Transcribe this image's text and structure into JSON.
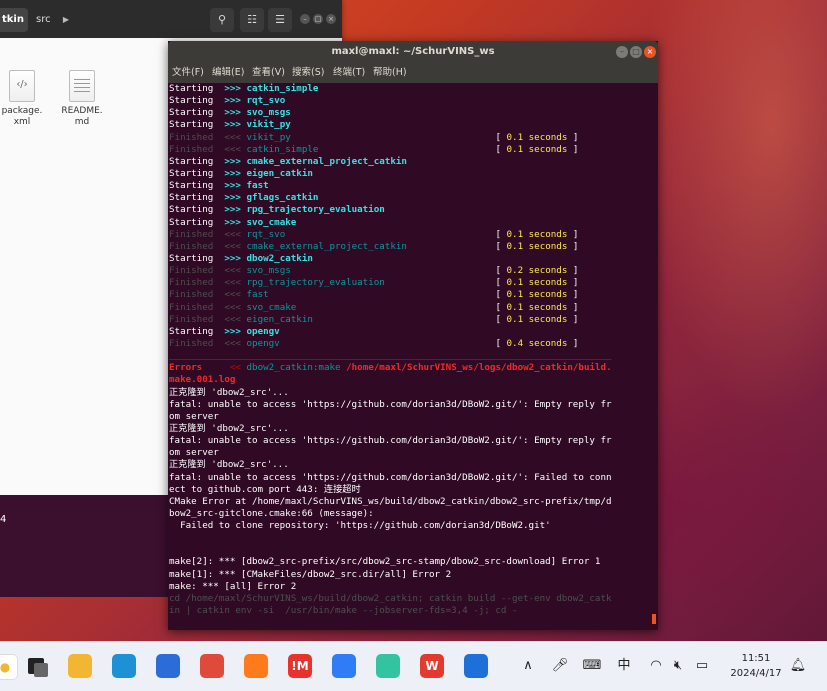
{
  "file_manager": {
    "breadcrumb": [
      "tkin",
      "src"
    ],
    "files": [
      {
        "name": "package.\nxml",
        "icon": "xml-file-icon"
      },
      {
        "name": "README.\nmd",
        "icon": "text-file-icon"
      }
    ]
  },
  "left_strip_text": "4",
  "terminal": {
    "title": "maxl@maxl: ~/SchurVINS_ws",
    "menu": [
      "文件(F)",
      "编辑(E)",
      "查看(V)",
      "搜索(S)",
      "终端(T)",
      "帮助(H)"
    ],
    "lines": [
      {
        "a": "Starting",
        "b": ">>>",
        "c": "catkin_simple",
        "kind": "start"
      },
      {
        "a": "Starting",
        "b": ">>>",
        "c": "rqt_svo",
        "kind": "start"
      },
      {
        "a": "Starting",
        "b": ">>>",
        "c": "svo_msgs",
        "kind": "start"
      },
      {
        "a": "Starting",
        "b": ">>>",
        "c": "vikit_py",
        "kind": "start"
      },
      {
        "a": "Finished",
        "b": "<<<",
        "c": "vikit_py",
        "t": "0.1 seconds",
        "kind": "finish"
      },
      {
        "a": "Finished",
        "b": "<<<",
        "c": "catkin_simple",
        "t": "0.1 seconds",
        "kind": "finish"
      },
      {
        "a": "Starting",
        "b": ">>>",
        "c": "cmake_external_project_catkin",
        "kind": "start"
      },
      {
        "a": "Starting",
        "b": ">>>",
        "c": "eigen_catkin",
        "kind": "start"
      },
      {
        "a": "Starting",
        "b": ">>>",
        "c": "fast",
        "kind": "start"
      },
      {
        "a": "Starting",
        "b": ">>>",
        "c": "gflags_catkin",
        "kind": "start"
      },
      {
        "a": "Starting",
        "b": ">>>",
        "c": "rpg_trajectory_evaluation",
        "kind": "start"
      },
      {
        "a": "Starting",
        "b": ">>>",
        "c": "svo_cmake",
        "kind": "start"
      },
      {
        "a": "Finished",
        "b": "<<<",
        "c": "rqt_svo",
        "t": "0.1 seconds",
        "kind": "finish"
      },
      {
        "a": "Finished",
        "b": "<<<",
        "c": "cmake_external_project_catkin",
        "t": "0.1 seconds",
        "kind": "finish"
      },
      {
        "a": "Starting",
        "b": ">>>",
        "c": "dbow2_catkin",
        "kind": "start"
      },
      {
        "a": "Finished",
        "b": "<<<",
        "c": "svo_msgs",
        "t": "0.2 seconds",
        "kind": "finish"
      },
      {
        "a": "Finished",
        "b": "<<<",
        "c": "rpg_trajectory_evaluation",
        "t": "0.1 seconds",
        "kind": "finish"
      },
      {
        "a": "Finished",
        "b": "<<<",
        "c": "fast",
        "t": "0.1 seconds",
        "kind": "finish"
      },
      {
        "a": "Finished",
        "b": "<<<",
        "c": "svo_cmake",
        "t": "0.1 seconds",
        "kind": "finish"
      },
      {
        "a": "Finished",
        "b": "<<<",
        "c": "eigen_catkin",
        "t": "0.1 seconds",
        "kind": "finish"
      },
      {
        "a": "Starting",
        "b": ">>>",
        "c": "opengv",
        "kind": "start"
      },
      {
        "a": "Finished",
        "b": "<<<",
        "c": "opengv",
        "t": "0.4 seconds",
        "kind": "finish"
      },
      {
        "text": "________________________________________________________________________________",
        "kind": "separator"
      },
      {
        "a": "Errors",
        "b": "<<",
        "c": "dbow2_catkin",
        "m": ":make",
        "p": " /home/maxl/SchurVINS_ws/logs/dbow2_catkin/build.",
        "kind": "error"
      },
      {
        "text": "make.001.log",
        "kind": "errpath"
      },
      {
        "text": "正克隆到 'dbow2_src'...",
        "kind": "plain"
      },
      {
        "text": "fatal: unable to access 'https://github.com/dorian3d/DBoW2.git/': Empty reply fr",
        "kind": "plain"
      },
      {
        "text": "om server",
        "kind": "plain"
      },
      {
        "text": "正克隆到 'dbow2_src'...",
        "kind": "plain"
      },
      {
        "text": "fatal: unable to access 'https://github.com/dorian3d/DBoW2.git/': Empty reply fr",
        "kind": "plain"
      },
      {
        "text": "om server",
        "kind": "plain"
      },
      {
        "text": "正克隆到 'dbow2_src'...",
        "kind": "plain"
      },
      {
        "text": "fatal: unable to access 'https://github.com/dorian3d/DBoW2.git/': Failed to conn",
        "kind": "plain"
      },
      {
        "text": "ect to github.com port 443: 连接超时",
        "kind": "plain"
      },
      {
        "text": "CMake Error at /home/maxl/SchurVINS_ws/build/dbow2_catkin/dbow2_src-prefix/tmp/d",
        "kind": "plain"
      },
      {
        "text": "bow2_src-gitclone.cmake:66 (message):",
        "kind": "plain"
      },
      {
        "text": "  Failed to clone repository: 'https://github.com/dorian3d/DBoW2.git'",
        "kind": "plain"
      },
      {
        "text": "",
        "kind": "plain"
      },
      {
        "text": "",
        "kind": "plain"
      },
      {
        "text": "make[2]: *** [dbow2_src-prefix/src/dbow2_src-stamp/dbow2_src-download] Error 1",
        "kind": "plain"
      },
      {
        "text": "make[1]: *** [CMakeFiles/dbow2_src.dir/all] Error 2",
        "kind": "plain"
      },
      {
        "text": "make: *** [all] Error 2",
        "kind": "plain"
      },
      {
        "text": "cd /home/maxl/SchurVINS_ws/build/dbow2_catkin; catkin build --get-env dbow2_catk",
        "kind": "dim"
      },
      {
        "text": "in | catkin env -si  /usr/bin/make --jobserver-fds=3,4 -j; cd -",
        "kind": "dim"
      }
    ]
  },
  "taskbar": {
    "apps": [
      {
        "name": "file-explorer-icon",
        "color": "#f2b632"
      },
      {
        "name": "edge-icon",
        "color": "#1e90d6"
      },
      {
        "name": "store-icon",
        "color": "#2b6cd8"
      },
      {
        "name": "snipping-icon",
        "color": "#e04a3a"
      },
      {
        "name": "firefox-icon",
        "color": "#ff7a1a"
      },
      {
        "name": "app-red-icon",
        "color": "#e8322c",
        "label": "!M"
      },
      {
        "name": "feishu-icon",
        "color": "#2f7cf6"
      },
      {
        "name": "chat-icon",
        "color": "#34c3a0"
      },
      {
        "name": "wps-icon",
        "color": "#e23a2e",
        "label": "W"
      },
      {
        "name": "phone-link-icon",
        "color": "#1e6fd8"
      }
    ],
    "tray": {
      "ime": "中",
      "time": "11:51",
      "date": "2024/4/17"
    }
  }
}
